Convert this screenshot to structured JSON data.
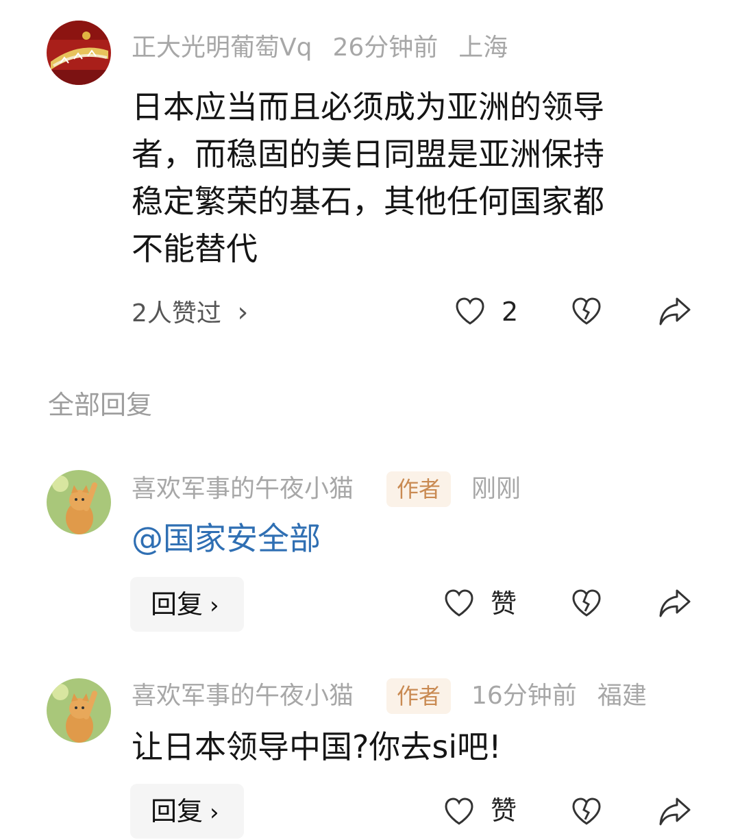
{
  "main_comment": {
    "username": "正大光明葡萄Vq",
    "time": "26分钟前",
    "location": "上海",
    "lines": [
      "日本应当而且必须成为亚洲的领导",
      "者，而稳固的美日同盟是亚洲保持",
      "稳定繁荣的基石，其他任何国家都",
      "不能替代"
    ],
    "likes_summary": "2人赞过",
    "like_count": "2"
  },
  "section_title": "全部回复",
  "replies": [
    {
      "username": "喜欢军事的午夜小猫",
      "badge": "作者",
      "time": "刚刚",
      "location": "",
      "text": "@国家安全部",
      "reply_label": "回复",
      "like_label": "赞"
    },
    {
      "username": "喜欢军事的午夜小猫",
      "badge": "作者",
      "time": "16分钟前",
      "location": "福建",
      "text": "让日本领导中国?你去si吧!",
      "reply_label": "回复",
      "like_label": "赞"
    }
  ],
  "icons": {
    "chevron": "›",
    "like": "heart-outline-icon",
    "dislike": "broken-heart-icon",
    "share": "share-arrow-icon"
  },
  "colors": {
    "mention": "#2f6fb3",
    "badge_bg": "#fbf2e8",
    "badge_text": "#c98a52",
    "meta_text": "#a7a7a7"
  }
}
